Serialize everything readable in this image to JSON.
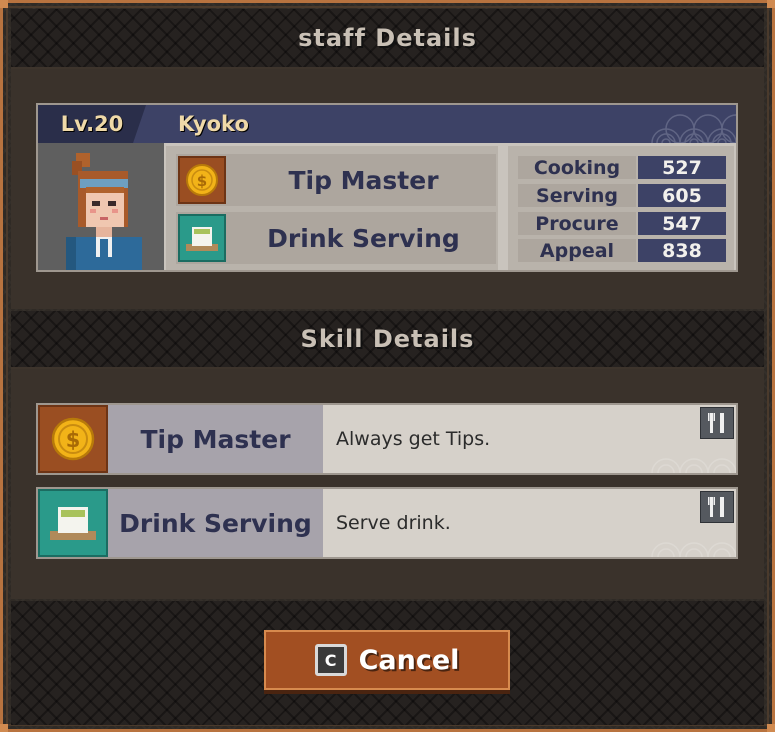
{
  "header": {
    "title": "staff Details"
  },
  "staff": {
    "level": "Lv.20",
    "name": "Kyoko",
    "skills": [
      {
        "label": "Tip Master",
        "icon": "gold-coin-icon"
      },
      {
        "label": "Drink Serving",
        "icon": "tea-cup-icon"
      }
    ],
    "stats": [
      {
        "label": "Cooking",
        "value": "527"
      },
      {
        "label": "Serving",
        "value": "605"
      },
      {
        "label": "Procure",
        "value": "547"
      },
      {
        "label": "Appeal",
        "value": "838"
      }
    ]
  },
  "skill_section": {
    "title": "Skill Details",
    "items": [
      {
        "name": "Tip Master",
        "desc": "Always get Tips.",
        "icon": "gold-coin-icon",
        "type_icon": "fork-knife-icon"
      },
      {
        "name": "Drink Serving",
        "desc": "Serve drink.",
        "icon": "tea-cup-icon",
        "type_icon": "fork-knife-icon"
      }
    ]
  },
  "footer": {
    "cancel_key": "C",
    "cancel_label": "Cancel"
  },
  "colors": {
    "frame": "#b8733f",
    "accent_navy": "#3d4266",
    "button": "#a24f22"
  }
}
